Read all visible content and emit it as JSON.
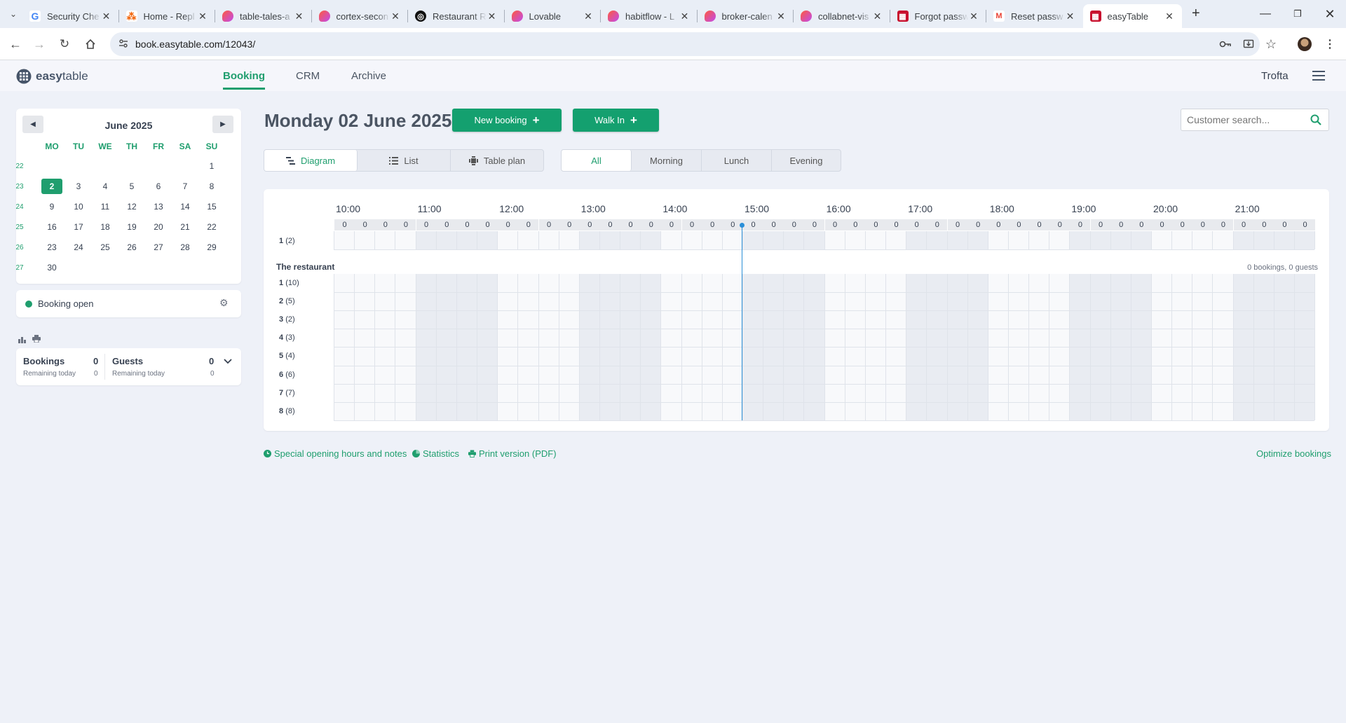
{
  "browser": {
    "tabs": [
      {
        "title": "Security Che",
        "icon": "google-icon",
        "color": "#4285f4",
        "glyph": "G"
      },
      {
        "title": "Home - Repl",
        "icon": "replit-icon",
        "color": "#f26207",
        "glyph": "⁂"
      },
      {
        "title": "table-tales-a",
        "icon": "lovable-icon",
        "color": "#e94b8a",
        "glyph": ""
      },
      {
        "title": "cortex-secon",
        "icon": "lovable-icon",
        "color": "#e94b8a",
        "glyph": ""
      },
      {
        "title": "Restaurant R",
        "icon": "openai-icon",
        "color": "#111111",
        "glyph": "◎"
      },
      {
        "title": "Lovable",
        "icon": "lovable-icon",
        "color": "#e94b8a",
        "glyph": ""
      },
      {
        "title": "habitflow - L",
        "icon": "lovable-icon",
        "color": "#e94b8a",
        "glyph": ""
      },
      {
        "title": "broker-calen",
        "icon": "lovable-icon",
        "color": "#e94b8a",
        "glyph": ""
      },
      {
        "title": "collabnet-vis",
        "icon": "lovable-icon",
        "color": "#e94b8a",
        "glyph": ""
      },
      {
        "title": "Forgot passw",
        "icon": "easytable-icon",
        "color": "#c8102e",
        "glyph": "▦"
      },
      {
        "title": "Reset passw",
        "icon": "gmail-icon",
        "color": "#ea4335",
        "glyph": "M"
      },
      {
        "title": "easyTable",
        "icon": "easytable-icon",
        "color": "#c8102e",
        "glyph": "▦",
        "active": true
      }
    ],
    "url": "book.easytable.com/12043/"
  },
  "app": {
    "logo_easy": "easy",
    "logo_table": "table",
    "nav": [
      "Booking",
      "CRM",
      "Archive"
    ],
    "user": "Trofta"
  },
  "calendar": {
    "month": "June 2025",
    "weekdays": [
      "MO",
      "TU",
      "WE",
      "TH",
      "FR",
      "SA",
      "SU"
    ],
    "weeks": [
      {
        "wk": "22",
        "days": [
          "",
          "",
          "",
          "",
          "",
          "",
          "1"
        ]
      },
      {
        "wk": "23",
        "days": [
          "2",
          "3",
          "4",
          "5",
          "6",
          "7",
          "8"
        ]
      },
      {
        "wk": "24",
        "days": [
          "9",
          "10",
          "11",
          "12",
          "13",
          "14",
          "15"
        ]
      },
      {
        "wk": "25",
        "days": [
          "16",
          "17",
          "18",
          "19",
          "20",
          "21",
          "22"
        ]
      },
      {
        "wk": "26",
        "days": [
          "23",
          "24",
          "25",
          "26",
          "27",
          "28",
          "29"
        ]
      },
      {
        "wk": "27",
        "days": [
          "30",
          "",
          "",
          "",
          "",
          "",
          ""
        ]
      }
    ],
    "selected": "2"
  },
  "status": {
    "label": "Booking open",
    "color": "#1f9e6e"
  },
  "stats": {
    "bookings_label": "Bookings",
    "bookings_value": "0",
    "bookings_sub": "Remaining today",
    "bookings_sub_value": "0",
    "guests_label": "Guests",
    "guests_value": "0",
    "guests_sub": "Remaining today",
    "guests_sub_value": "0"
  },
  "main": {
    "date_title": "Monday 02 June 2025",
    "new_booking": "New booking",
    "walk_in": "Walk In",
    "search_placeholder": "Customer search...",
    "views": [
      "Diagram",
      "List",
      "Table plan"
    ],
    "periods": [
      "All",
      "Morning",
      "Lunch",
      "Evening"
    ],
    "hours": [
      "10:00",
      "11:00",
      "12:00",
      "13:00",
      "14:00",
      "15:00",
      "16:00",
      "17:00",
      "18:00",
      "19:00",
      "20:00",
      "21:00"
    ],
    "slot_count_value": "0",
    "top_row": {
      "num": "1",
      "cap": "(2)"
    },
    "section_title": "The restaurant",
    "section_summary": "0 bookings, 0 guests",
    "tables": [
      {
        "num": "1",
        "cap": "(10)"
      },
      {
        "num": "2",
        "cap": "(5)"
      },
      {
        "num": "3",
        "cap": "(2)"
      },
      {
        "num": "4",
        "cap": "(3)"
      },
      {
        "num": "5",
        "cap": "(4)"
      },
      {
        "num": "6",
        "cap": "(6)"
      },
      {
        "num": "7",
        "cap": "(7)"
      },
      {
        "num": "8",
        "cap": "(8)"
      }
    ]
  },
  "footer": {
    "special_hours": "Special opening hours and notes",
    "statistics": "Statistics",
    "print": "Print version (PDF)",
    "optimize": "Optimize bookings"
  }
}
